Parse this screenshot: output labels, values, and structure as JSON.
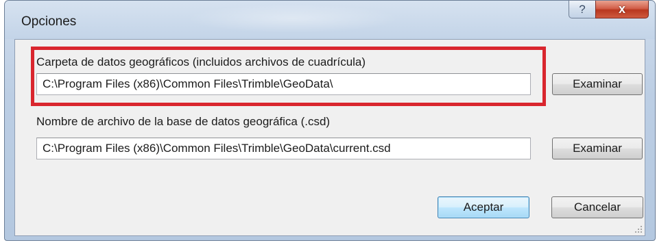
{
  "window": {
    "title": "Opciones",
    "help_glyph": "?",
    "close_glyph": "x"
  },
  "geodata_folder": {
    "label": "Carpeta de datos geográficos (incluidos archivos de cuadrícula)",
    "value": "C:\\Program Files (x86)\\Common Files\\Trimble\\GeoData\\",
    "browse_label": "Examinar"
  },
  "geodatabase_file": {
    "label": "Nombre de archivo de la base de datos geográfica (.csd)",
    "value": "C:\\Program Files (x86)\\Common Files\\Trimble\\GeoData\\current.csd",
    "browse_label": "Examinar"
  },
  "footer": {
    "ok_label": "Aceptar",
    "cancel_label": "Cancelar"
  },
  "colors": {
    "highlight": "#d9262e",
    "default_button_border": "#3c7fb1",
    "close_button": "#c4452c"
  }
}
